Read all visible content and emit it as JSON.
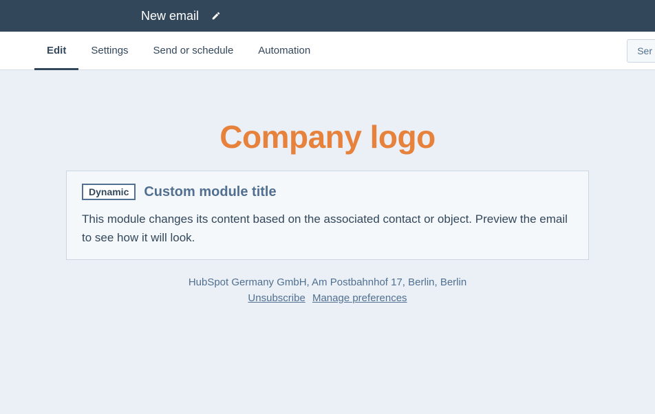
{
  "header": {
    "title": "New email"
  },
  "tabs": {
    "edit": "Edit",
    "settings": "Settings",
    "send": "Send or schedule",
    "automation": "Automation"
  },
  "actions": {
    "send_partial": "Ser"
  },
  "email": {
    "logo_text": "Company logo",
    "module": {
      "badge": "Dynamic",
      "title": "Custom module title",
      "description": "This module changes its content based on the associated contact or object. Preview the email to see how it will look."
    },
    "footer": {
      "address": "HubSpot Germany GmbH, Am Postbahnhof 17, Berlin, Berlin",
      "unsubscribe": "Unsubscribe",
      "manage": "Manage preferences"
    }
  }
}
